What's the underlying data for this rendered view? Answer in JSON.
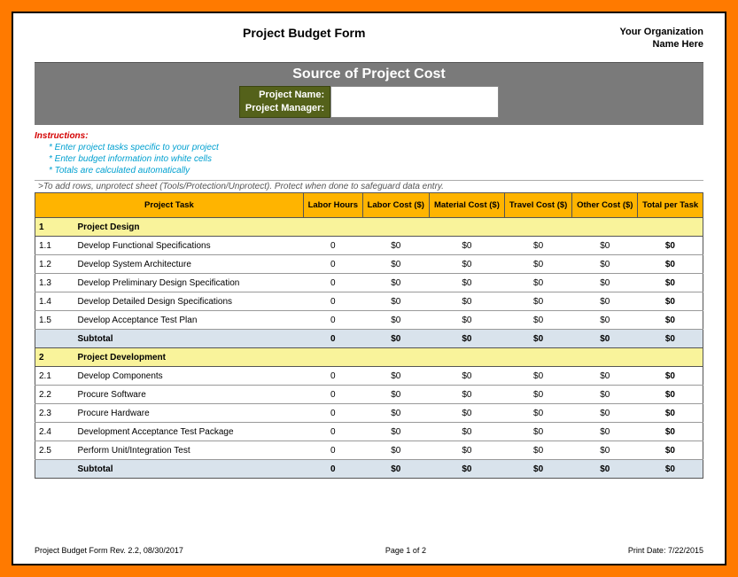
{
  "title": "Project Budget Form",
  "org_line1": "Your Organization",
  "org_line2": "Name Here",
  "banner_title": "Source of Project Cost",
  "label_project_name": "Project Name:",
  "label_project_manager": "Project Manager:",
  "value_project_name": "",
  "value_project_manager": "",
  "instructions_label": "Instructions:",
  "inst1": "* Enter project tasks specific to your project",
  "inst2": "* Enter budget information into white cells",
  "inst3": "* Totals are calculated automatically",
  "protect_note": ">To add rows, unprotect sheet (Tools/Protection/Unprotect).  Protect when done to safeguard data entry.",
  "columns": {
    "task": "Project Task",
    "labor_hours": "Labor Hours",
    "labor_cost": "Labor Cost ($)",
    "material": "Material Cost ($)",
    "travel": "Travel Cost ($)",
    "other": "Other Cost ($)",
    "total": "Total per Task"
  },
  "sections": [
    {
      "num": "1",
      "name": "Project Design",
      "rows": [
        {
          "num": "1.1",
          "task": "Develop Functional Specifications",
          "hours": "0",
          "labor": "$0",
          "material": "$0",
          "travel": "$0",
          "other": "$0",
          "total": "$0"
        },
        {
          "num": "1.2",
          "task": "Develop System Architecture",
          "hours": "0",
          "labor": "$0",
          "material": "$0",
          "travel": "$0",
          "other": "$0",
          "total": "$0"
        },
        {
          "num": "1.3",
          "task": "Develop Preliminary Design Specification",
          "hours": "0",
          "labor": "$0",
          "material": "$0",
          "travel": "$0",
          "other": "$0",
          "total": "$0"
        },
        {
          "num": "1.4",
          "task": "Develop Detailed Design Specifications",
          "hours": "0",
          "labor": "$0",
          "material": "$0",
          "travel": "$0",
          "other": "$0",
          "total": "$0"
        },
        {
          "num": "1.5",
          "task": "Develop Acceptance Test Plan",
          "hours": "0",
          "labor": "$0",
          "material": "$0",
          "travel": "$0",
          "other": "$0",
          "total": "$0"
        }
      ],
      "subtotal": {
        "label": "Subtotal",
        "hours": "0",
        "labor": "$0",
        "material": "$0",
        "travel": "$0",
        "other": "$0",
        "total": "$0"
      }
    },
    {
      "num": "2",
      "name": "Project Development",
      "rows": [
        {
          "num": "2.1",
          "task": "Develop Components",
          "hours": "0",
          "labor": "$0",
          "material": "$0",
          "travel": "$0",
          "other": "$0",
          "total": "$0"
        },
        {
          "num": "2.2",
          "task": "Procure Software",
          "hours": "0",
          "labor": "$0",
          "material": "$0",
          "travel": "$0",
          "other": "$0",
          "total": "$0"
        },
        {
          "num": "2.3",
          "task": "Procure Hardware",
          "hours": "0",
          "labor": "$0",
          "material": "$0",
          "travel": "$0",
          "other": "$0",
          "total": "$0"
        },
        {
          "num": "2.4",
          "task": "Development Acceptance Test Package",
          "hours": "0",
          "labor": "$0",
          "material": "$0",
          "travel": "$0",
          "other": "$0",
          "total": "$0"
        },
        {
          "num": "2.5",
          "task": "Perform Unit/Integration Test",
          "hours": "0",
          "labor": "$0",
          "material": "$0",
          "travel": "$0",
          "other": "$0",
          "total": "$0"
        }
      ],
      "subtotal": {
        "label": "Subtotal",
        "hours": "0",
        "labor": "$0",
        "material": "$0",
        "travel": "$0",
        "other": "$0",
        "total": "$0"
      }
    }
  ],
  "footer_left": "Project Budget Form Rev. 2.2, 08/30/2017",
  "footer_center": "Page 1 of 2",
  "footer_right": "Print Date: 7/22/2015"
}
